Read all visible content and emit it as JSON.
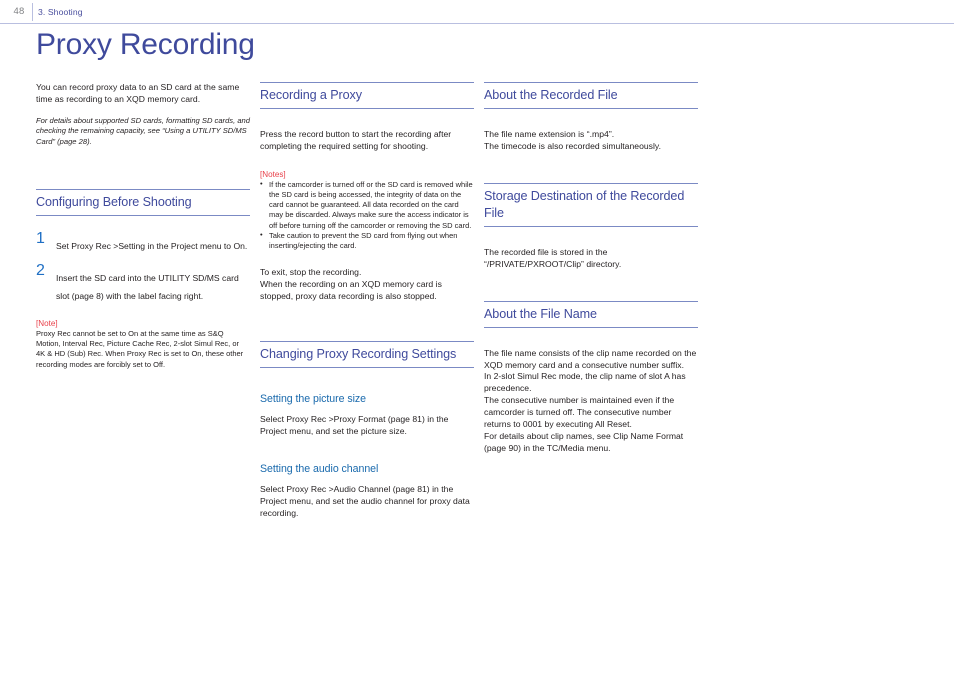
{
  "header": {
    "folio": "48",
    "chapter": "3. Shooting"
  },
  "title": "Proxy Recording",
  "colors": {
    "heading": "#3f4a9c",
    "subheading": "#1a6aad",
    "step_number": "#1f6fc4",
    "note_label": "#e8404a",
    "rule": "#7b8ac4",
    "body_text": "#231f20"
  },
  "column1": {
    "intro": "You can record proxy data to an SD card at the same time as recording to an XQD memory card.",
    "intro_note": "For details about supported SD cards, formatting SD cards, and checking the remaining capacity, see “Using a UTILITY SD/MS Card” (page 28).",
    "heading": "Configuring Before Shooting",
    "steps": [
      {
        "num": "1",
        "text": "Set Proxy Rec >Setting in the Project menu to On."
      },
      {
        "num": "2",
        "text": "Insert the SD card into the UTILITY SD/MS card slot (page 8) with the label facing right."
      }
    ],
    "note_label": "[Note]",
    "note_body": "Proxy Rec cannot be set to On at the same time as S&Q Motion, Interval Rec, Picture Cache Rec, 2-slot Simul Rec, or 4K & HD (Sub) Rec. When Proxy Rec is set to On, these other recording modes are forcibly set to Off."
  },
  "column2": {
    "heading": "Recording a Proxy",
    "paragraph1": "Press the record button to start the recording after completing the required setting for shooting.",
    "notes_label": "[Notes]",
    "notes": [
      "If the camcorder is turned off or the SD card is removed while the SD card is being accessed, the integrity of data on the card cannot be guaranteed. All data recorded on the card may be discarded. Always make sure the access indicator is off before turning off the camcorder or removing the SD card.",
      "Take caution to prevent the SD card from flying out when inserting/ejecting the card."
    ],
    "paragraph2": "To exit, stop the recording.\nWhen the recording on an XQD memory card is stopped, proxy data recording is also stopped.",
    "heading2": "Changing Proxy Recording Settings",
    "sub1_heading": "Setting the picture size",
    "sub1_body": "Select Proxy Rec >Proxy Format (page 81) in the Project menu, and set the picture size.",
    "sub2_heading": "Setting the audio channel",
    "sub2_body": "Select Proxy Rec >Audio Channel (page 81) in the Project menu, and set the audio channel for proxy data recording."
  },
  "column3": {
    "heading1": "About the Recorded File",
    "body1": "The file name extension is “.mp4”.\nThe timecode is also recorded simultaneously.",
    "heading2": "Storage Destination of the Recorded File",
    "body2": "The recorded file is stored in the “/PRIVATE/PXROOT/Clip” directory.",
    "heading3": "About the File Name",
    "body3": "The file name consists of the clip name recorded on the XQD memory card and a consecutive number suffix.\nIn 2-slot Simul Rec mode, the clip name of slot A has precedence.\nThe consecutive number is maintained even if the camcorder is turned off. The consecutive number returns to 0001 by executing All Reset.\nFor details about clip names, see Clip Name Format (page 90) in the TC/Media menu."
  }
}
